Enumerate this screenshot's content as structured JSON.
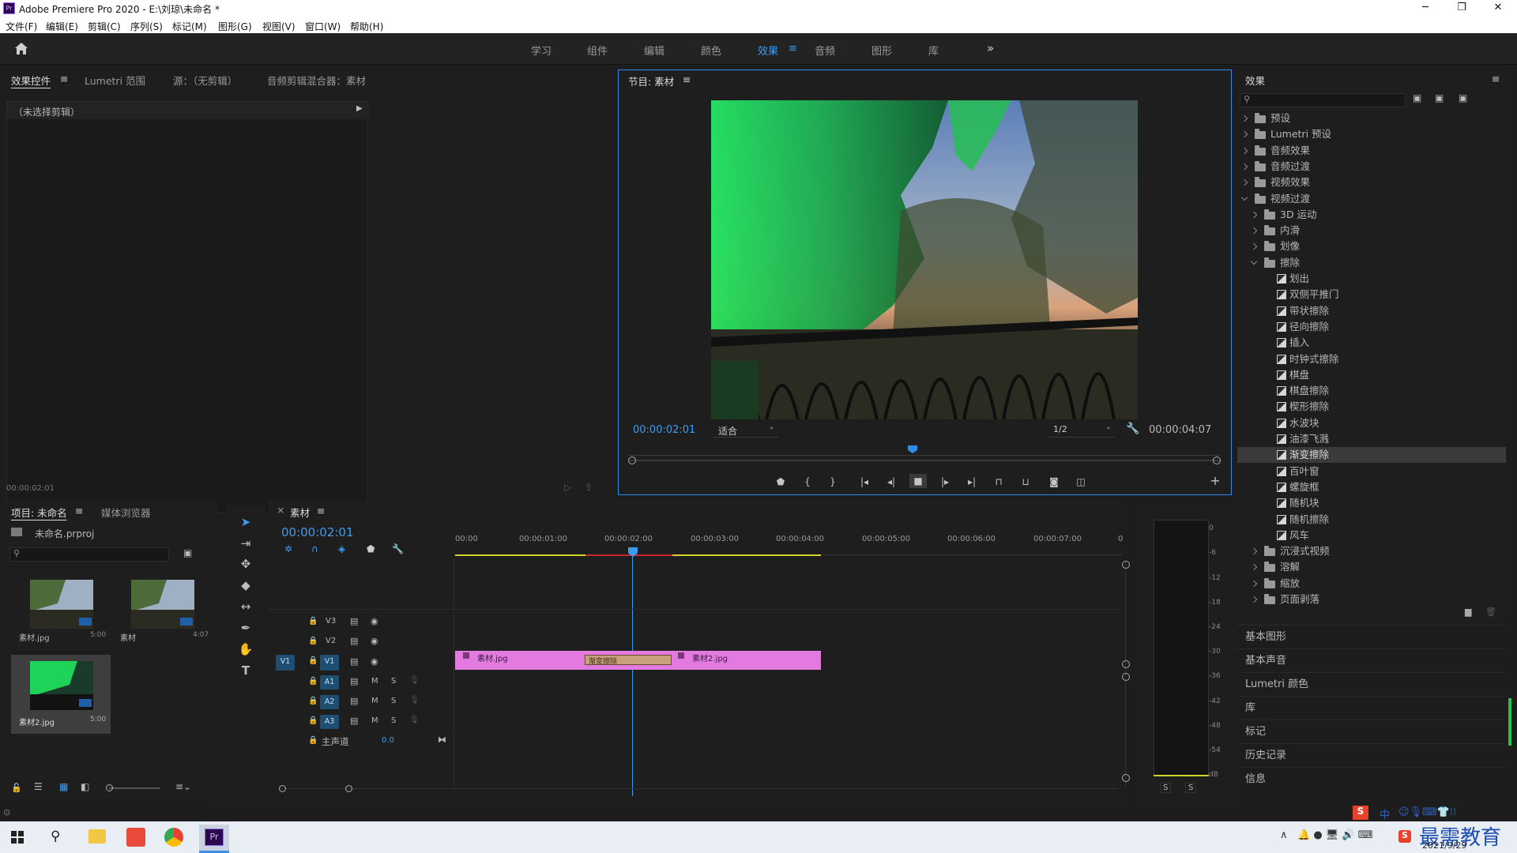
{
  "window": {
    "title": "Adobe Premiere Pro 2020 - E:\\刘琼\\未命名 *",
    "logo": "Pr",
    "minimize": "─",
    "maximize": "❐",
    "close": "✕"
  },
  "menu": [
    "文件(F)",
    "编辑(E)",
    "剪辑(C)",
    "序列(S)",
    "标记(M)",
    "图形(G)",
    "视图(V)",
    "窗口(W)",
    "帮助(H)"
  ],
  "workspaces": [
    "学习",
    "组件",
    "编辑",
    "颜色",
    "效果",
    "音频",
    "图形",
    "库"
  ],
  "workspaces_active": "效果",
  "workspaces_more": "»",
  "effect_controls": {
    "tabs": [
      "效果控件",
      "Lumetri 范围",
      "源：（无剪辑）",
      "音频剪辑混合器：素材"
    ],
    "no_clip": "（未选择剪辑）",
    "time": "00:00:02:01"
  },
  "program_monitor": {
    "title": "节目: 素材",
    "current_time": "00:00:02:01",
    "fit": "适合",
    "resolution": "1/2",
    "duration": "00:00:04:07"
  },
  "project": {
    "tabs": [
      "项目: 未命名",
      "媒体浏览器"
    ],
    "file": "未命名.prproj",
    "items": [
      {
        "name": "素材.jpg",
        "duration": "5:00"
      },
      {
        "name": "素材",
        "duration": "4:07"
      },
      {
        "name": "素材2.jpg",
        "duration": "5:00"
      }
    ]
  },
  "timeline": {
    "tab": "素材",
    "current_time": "00:00:02:01",
    "ruler": [
      "00:00",
      "00:00:01:00",
      "00:00:02:00",
      "00:00:03:00",
      "00:00:04:00",
      "00:00:05:00",
      "00:00:06:00",
      "00:00:07:00",
      "0"
    ],
    "video_tracks": [
      "V3",
      "V2",
      "V1"
    ],
    "audio_tracks": [
      "A1",
      "A2",
      "A3"
    ],
    "master": "主声道",
    "master_value": "0.0",
    "src_v": "V1",
    "clips": {
      "clip1": "素材.jpg",
      "transition": "渐变擦除",
      "clip2": "素材2.jpg"
    },
    "mute": "M",
    "solo": "S"
  },
  "meter": {
    "labels": [
      "0",
      "-6",
      "-12",
      "-18",
      "-24",
      "-30",
      "-36",
      "-42",
      "-48",
      "-54",
      "dB"
    ],
    "solo": [
      "S",
      "S"
    ]
  },
  "effects_panel": {
    "title": "效果",
    "tree": [
      {
        "label": "预设",
        "level": 0,
        "type": "folder-star",
        "open": false
      },
      {
        "label": "Lumetri 预设",
        "level": 0,
        "type": "folder-star",
        "open": false
      },
      {
        "label": "音频效果",
        "level": 0,
        "type": "folder",
        "open": false
      },
      {
        "label": "音频过渡",
        "level": 0,
        "type": "folder",
        "open": false
      },
      {
        "label": "视频效果",
        "level": 0,
        "type": "folder",
        "open": false
      },
      {
        "label": "视频过渡",
        "level": 0,
        "type": "folder",
        "open": true
      },
      {
        "label": "3D 运动",
        "level": 1,
        "type": "folder",
        "open": false
      },
      {
        "label": "内滑",
        "level": 1,
        "type": "folder",
        "open": false
      },
      {
        "label": "划像",
        "level": 1,
        "type": "folder",
        "open": false
      },
      {
        "label": "擦除",
        "level": 1,
        "type": "folder",
        "open": true
      },
      {
        "label": "划出",
        "level": 2,
        "type": "fx"
      },
      {
        "label": "双侧平推门",
        "level": 2,
        "type": "fx"
      },
      {
        "label": "带状擦除",
        "level": 2,
        "type": "fx"
      },
      {
        "label": "径向擦除",
        "level": 2,
        "type": "fx"
      },
      {
        "label": "插入",
        "level": 2,
        "type": "fx"
      },
      {
        "label": "时钟式擦除",
        "level": 2,
        "type": "fx"
      },
      {
        "label": "棋盘",
        "level": 2,
        "type": "fx"
      },
      {
        "label": "棋盘擦除",
        "level": 2,
        "type": "fx"
      },
      {
        "label": "楔形擦除",
        "level": 2,
        "type": "fx"
      },
      {
        "label": "水波块",
        "level": 2,
        "type": "fx"
      },
      {
        "label": "油漆飞溅",
        "level": 2,
        "type": "fx"
      },
      {
        "label": "渐变擦除",
        "level": 2,
        "type": "fx",
        "selected": true
      },
      {
        "label": "百叶窗",
        "level": 2,
        "type": "fx"
      },
      {
        "label": "螺旋框",
        "level": 2,
        "type": "fx"
      },
      {
        "label": "随机块",
        "level": 2,
        "type": "fx"
      },
      {
        "label": "随机擦除",
        "level": 2,
        "type": "fx"
      },
      {
        "label": "风车",
        "level": 2,
        "type": "fx"
      },
      {
        "label": "沉浸式视频",
        "level": 1,
        "type": "folder",
        "open": false
      },
      {
        "label": "溶解",
        "level": 1,
        "type": "folder",
        "open": false
      },
      {
        "label": "缩放",
        "level": 1,
        "type": "folder",
        "open": false
      },
      {
        "label": "页面剥落",
        "level": 1,
        "type": "folder",
        "open": false
      }
    ],
    "stack": [
      "基本图形",
      "基本声音",
      "Lumetri 颜色",
      "库",
      "标记",
      "历史记录",
      "信息"
    ]
  },
  "taskbar": {
    "date": "2021/9/29",
    "watermark": "最需教育",
    "ime": "中"
  },
  "colors": {
    "accent": "#2d8ceb",
    "clip": "#e27ae0",
    "transition": "#c8a07a",
    "work_area": "#d3d32a",
    "render_red": "#c8262a",
    "track_blue": "#1e4f73"
  }
}
